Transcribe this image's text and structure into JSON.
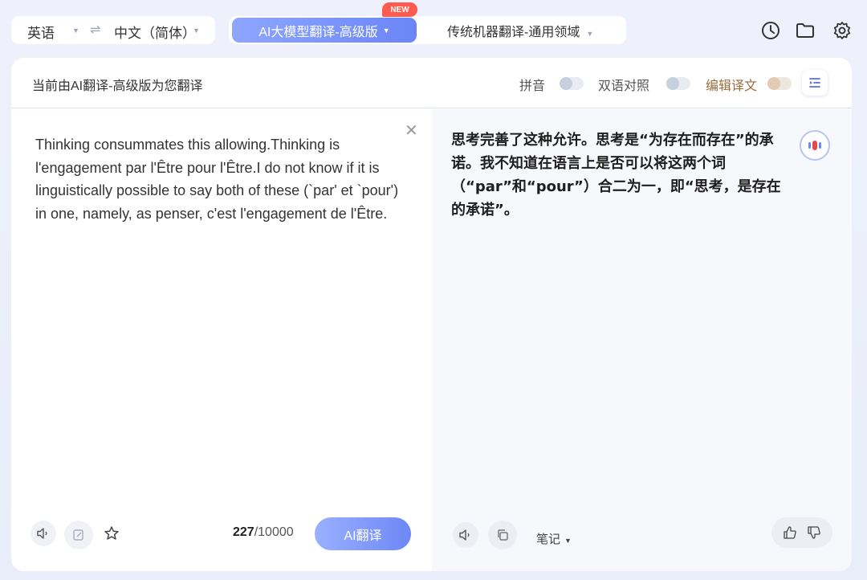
{
  "topbar": {
    "source_lang": "英语",
    "target_lang": "中文（简体）",
    "swap_icon": "swap-arrows-icon",
    "ai_mode_label": "AI大模型翻译-高级版",
    "new_badge": "NEW",
    "standard_mode_label": "传统机器翻译-通用领域",
    "icons": [
      "history-clock-icon",
      "folder-icon",
      "settings-gear-icon"
    ]
  },
  "header": {
    "title": "当前由AI翻译-高级版为您翻译",
    "pinyin_label": "拼音",
    "bilingual_label": "双语对照",
    "edit_label": "编辑译文",
    "edit_color": "#9c6b3c"
  },
  "source": {
    "text": "Thinking consummates this allowing.Thinking is l'engagement par l'Être pour l'Être.I do not know if it is linguistically possible to say both of these (`par' et `pour') in one, namely, as penser, c'est l'engagement de l'Être.",
    "char_count": "227",
    "char_max": "/10000",
    "translate_button": "AI翻译"
  },
  "target": {
    "text": "思考完善了这种允许。思考是“为存在而存在”的承诺。我不知道在语言上是否可以将这两个词（“par”和“pour”）合二为一，即“思考，是存在的承诺”。",
    "notes_label": "笔记"
  },
  "colors": {
    "accent": "#6d88f6",
    "new_badge": "#ff5a4d"
  }
}
